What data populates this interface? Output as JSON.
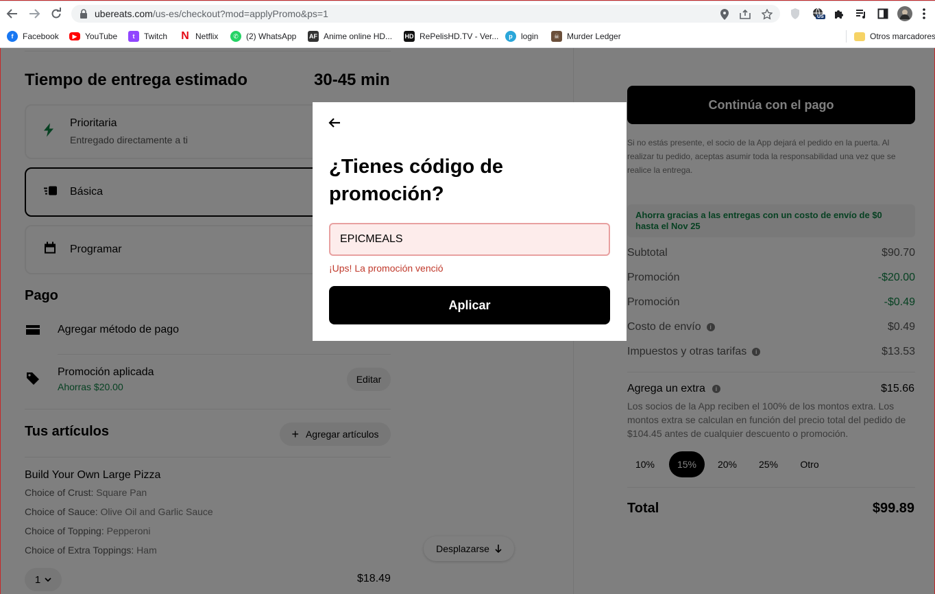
{
  "browser": {
    "url_host": "ubereats.com",
    "url_path": "/us-es/checkout?mod=applyPromo&ps=1",
    "bookmarks": [
      {
        "label": "Facebook",
        "icon": "facebook-icon",
        "color": "#1877f2"
      },
      {
        "label": "YouTube",
        "icon": "youtube-icon",
        "color": "#ff0000"
      },
      {
        "label": "Twitch",
        "icon": "twitch-icon",
        "color": "#9146ff"
      },
      {
        "label": "Netflix",
        "icon": "netflix-icon",
        "color": "#e50914"
      },
      {
        "label": "(2) WhatsApp",
        "icon": "whatsapp-icon",
        "color": "#25d366"
      },
      {
        "label": "Anime online HD...",
        "icon": "animeflv-icon",
        "color": "#333333"
      },
      {
        "label": "RePelisHD.TV - Ver...",
        "icon": "repelis-icon",
        "color": "#111111"
      },
      {
        "label": "login",
        "icon": "login-icon",
        "color": "#2aa6d9"
      },
      {
        "label": "Murder Ledger",
        "icon": "murder-ledger-icon",
        "color": "#6b4f3a"
      },
      {
        "label": "Otros marcadores",
        "icon": "folder-icon",
        "color": "#f6d365"
      }
    ],
    "ext_badge": "US"
  },
  "delivery": {
    "title": "Tiempo de entrega estimado",
    "time": "30-45 min",
    "options": [
      {
        "title": "Prioritaria",
        "subtitle": "Entregado directamente a ti"
      },
      {
        "title": "Básica"
      },
      {
        "title": "Programar"
      }
    ]
  },
  "payment": {
    "title": "Pago",
    "add_method": "Agregar método de pago",
    "promo_title": "Promoción aplicada",
    "promo_sub": "Ahorras $20.00",
    "edit_label": "Editar"
  },
  "items": {
    "title": "Tus artículos",
    "add_label": "Agregar artículos",
    "name": "Build Your Own Large Pizza",
    "options": [
      {
        "label": "Choice of Crust:",
        "value": "Square Pan"
      },
      {
        "label": "Choice of Sauce:",
        "value": "Olive Oil and Garlic Sauce"
      },
      {
        "label": "Choice of Topping:",
        "value": "Pepperoni"
      },
      {
        "label": "Choice of Extra Toppings:",
        "value": "Ham"
      }
    ],
    "qty": "1",
    "price": "$18.49",
    "scroll_label": "Desplazarse"
  },
  "summary": {
    "continue_label": "Continúa con el pago",
    "disclaimer": "Si no estás presente, el socio de la App dejará el pedido en la puerta. Al realizar tu pedido, aceptas asumir toda la responsabilidad una vez que se realice la entrega.",
    "banner": "Ahorra gracias a las entregas con un costo de envío de $0 hasta el Nov 25",
    "rows": [
      {
        "label": "Subtotal",
        "value": "$90.70"
      },
      {
        "label": "Promoción",
        "value": "-$20.00"
      },
      {
        "label": "Promoción",
        "value": "-$0.49"
      },
      {
        "label": "Costo de envío",
        "value": "$0.49"
      },
      {
        "label": "Impuestos y otras tarifas",
        "value": "$13.53"
      }
    ],
    "extra_title": "Agrega un extra",
    "extra_value": "$15.66",
    "extra_desc": "Los socios de la App reciben el 100% de los montos extra. Los montos extra se calculan en función del precio total del pedido de $104.45 antes de cualquier descuento o promoción.",
    "tips": [
      "10%",
      "15%",
      "20%",
      "25%",
      "Otro"
    ],
    "total_label": "Total",
    "total_value": "$99.89"
  },
  "modal": {
    "title": "¿Tienes código de promoción?",
    "input_value": "EPICMEALS",
    "error": "¡Ups! La promoción venció",
    "apply_label": "Aplicar"
  },
  "colors": {
    "uber_green": "#0e8345",
    "error_red": "#c0392b",
    "error_bg": "#fdeceb"
  }
}
